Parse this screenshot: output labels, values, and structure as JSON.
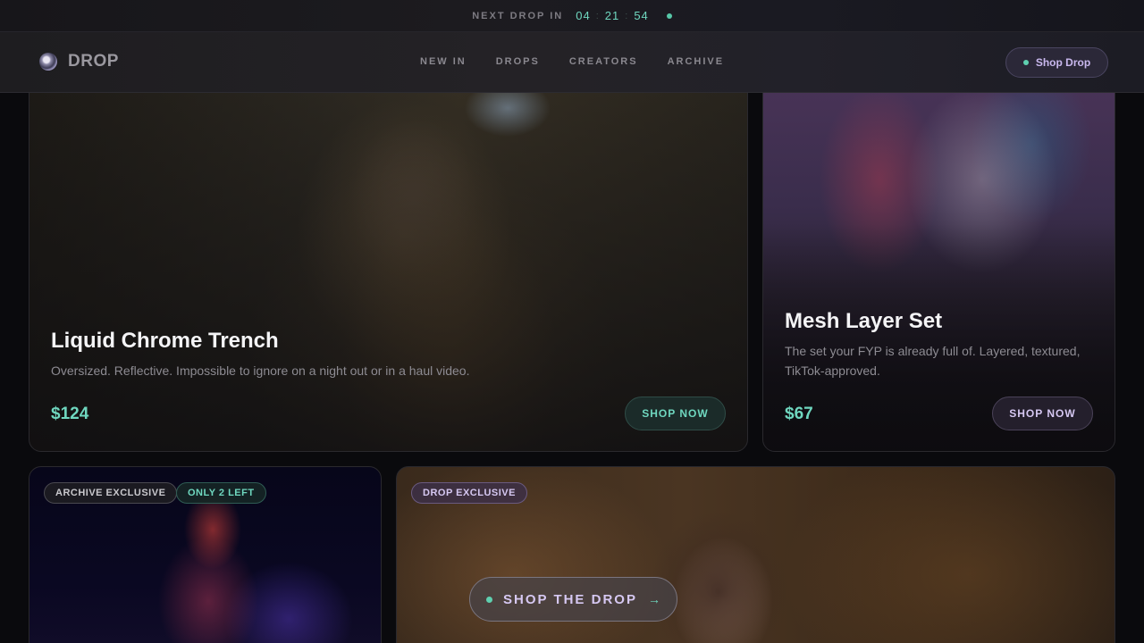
{
  "countdown": {
    "label": "NEXT DROP IN",
    "hours": "04",
    "minutes": "21",
    "seconds": "54",
    "separator": ":"
  },
  "header": {
    "brand": "DROP",
    "logo_icon": "chrome-orb-logo-icon",
    "nav": [
      "NEW IN",
      "DROPS",
      "CREATORS",
      "ARCHIVE"
    ],
    "cta_label": "Shop Drop"
  },
  "products": [
    {
      "title": "Liquid Chrome Trench",
      "description": "Oversized. Reflective. Impossible to ignore on a night out or in a haul video.",
      "price": "$124",
      "button": "SHOP NOW"
    },
    {
      "title": "Mesh Layer Set",
      "description_line1": "The set your FYP is already full of. Layered, textured,",
      "description_line2": "TikTok-approved.",
      "price": "$67",
      "button": "SHOP NOW"
    }
  ],
  "tiles": [
    {
      "badges": [
        "ARCHIVE EXCLUSIVE",
        "ONLY 2 LEFT"
      ]
    },
    {
      "badges": [
        "DROP EXCLUSIVE"
      ],
      "cta_label": "SHOP THE DROP",
      "cta_arrow": "→"
    }
  ],
  "colors": {
    "accent_teal": "#6fd7bf",
    "accent_violet": "#d6c8f2",
    "background": "#0a0a0d"
  }
}
